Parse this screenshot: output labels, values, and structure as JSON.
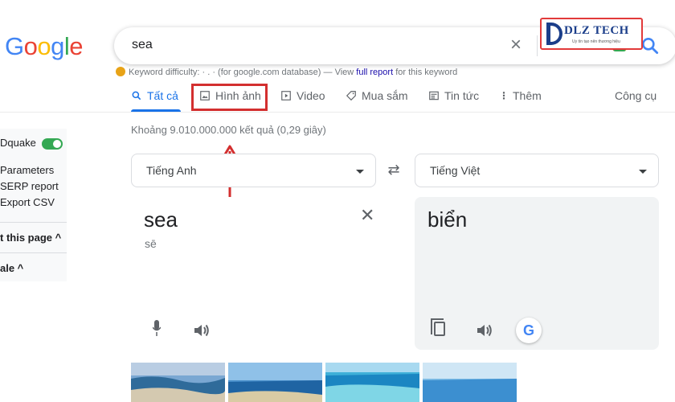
{
  "logo": {
    "letters": [
      "G",
      "o",
      "o",
      "g",
      "l",
      "e"
    ]
  },
  "search": {
    "query": "sea"
  },
  "watermark": {
    "brand": "DLZ TECH",
    "slogan": "Uy tín tạo nên thương hiệu"
  },
  "keyword": {
    "prefix": "Keyword difficulty: · . · (for google.com database) — View ",
    "link": "full report",
    "suffix": " for this keyword"
  },
  "tabs": [
    {
      "label": "Tất cả",
      "icon": "search-icon"
    },
    {
      "label": "Hình ảnh",
      "icon": "image-icon"
    },
    {
      "label": "Video",
      "icon": "play-icon"
    },
    {
      "label": "Mua sắm",
      "icon": "tag-icon"
    },
    {
      "label": "Tin tức",
      "icon": "news-icon"
    },
    {
      "label": "Thêm",
      "icon": "more-vert-icon"
    },
    {
      "label": "Công cụ",
      "icon": ""
    }
  ],
  "result_stats": "Khoảng 9.010.000.000 kết quả (0,29 giây)",
  "sidepanel": {
    "toggle_label": "Dquake",
    "links": [
      "Parameters",
      "SERP report",
      "Export CSV"
    ],
    "section1": "t this page ^",
    "section2": "ale ^"
  },
  "translate": {
    "source_lang": "Tiếng Anh",
    "target_lang": "Tiếng Việt",
    "source_text": "sea",
    "source_pronunciation": "sē",
    "target_text": "biển"
  },
  "colors": {
    "accent": "#1a73e8",
    "highlight": "#d32f2f",
    "toggle": "#34a853"
  }
}
